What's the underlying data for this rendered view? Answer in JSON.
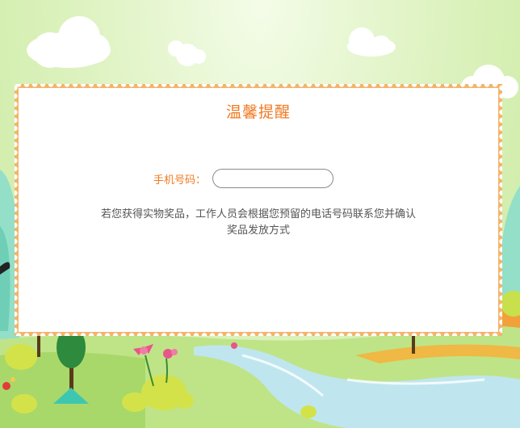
{
  "dialog": {
    "title": "温馨提醒",
    "phone_label": "手机号码：",
    "phone_value": "",
    "phone_placeholder": "",
    "notice_line1": "若您获得实物奖品，工作人员会根据您预留的电话号码联系您并确认",
    "notice_line2": "奖品发放方式"
  },
  "colors": {
    "accent": "#f07a22",
    "card_edge": "#f3b46a",
    "grass": "#b6e07a",
    "river": "#bfe6ef"
  },
  "decor": [
    "cloud",
    "tree",
    "flower",
    "bush",
    "river"
  ]
}
